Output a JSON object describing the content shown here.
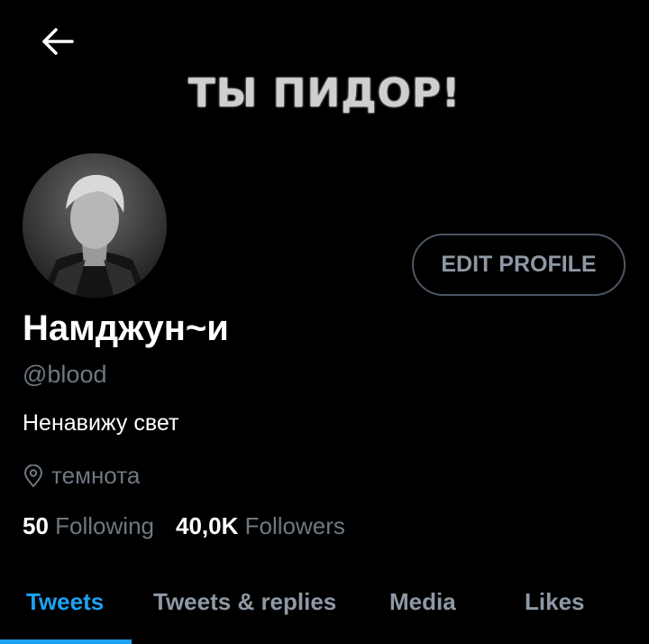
{
  "header": {
    "back_icon": "arrow-left-icon"
  },
  "banner": {
    "text": "ТЫ ПИДОР!"
  },
  "profile": {
    "display_name": "Намджун~и",
    "handle": "@blood",
    "bio": "Ненавижу свет",
    "location": "темнота",
    "location_icon": "location-pin-icon",
    "edit_button_label": "EDIT PROFILE"
  },
  "stats": {
    "following_count": "50",
    "following_label": "Following",
    "followers_count": "40,0K",
    "followers_label": "Followers"
  },
  "tabs": [
    {
      "label": "Tweets",
      "active": true
    },
    {
      "label": "Tweets & replies",
      "active": false
    },
    {
      "label": "Media",
      "active": false
    },
    {
      "label": "Likes",
      "active": false
    }
  ],
  "colors": {
    "accent": "#1da1f2",
    "muted_text": "#6e7881",
    "background": "#000000"
  }
}
